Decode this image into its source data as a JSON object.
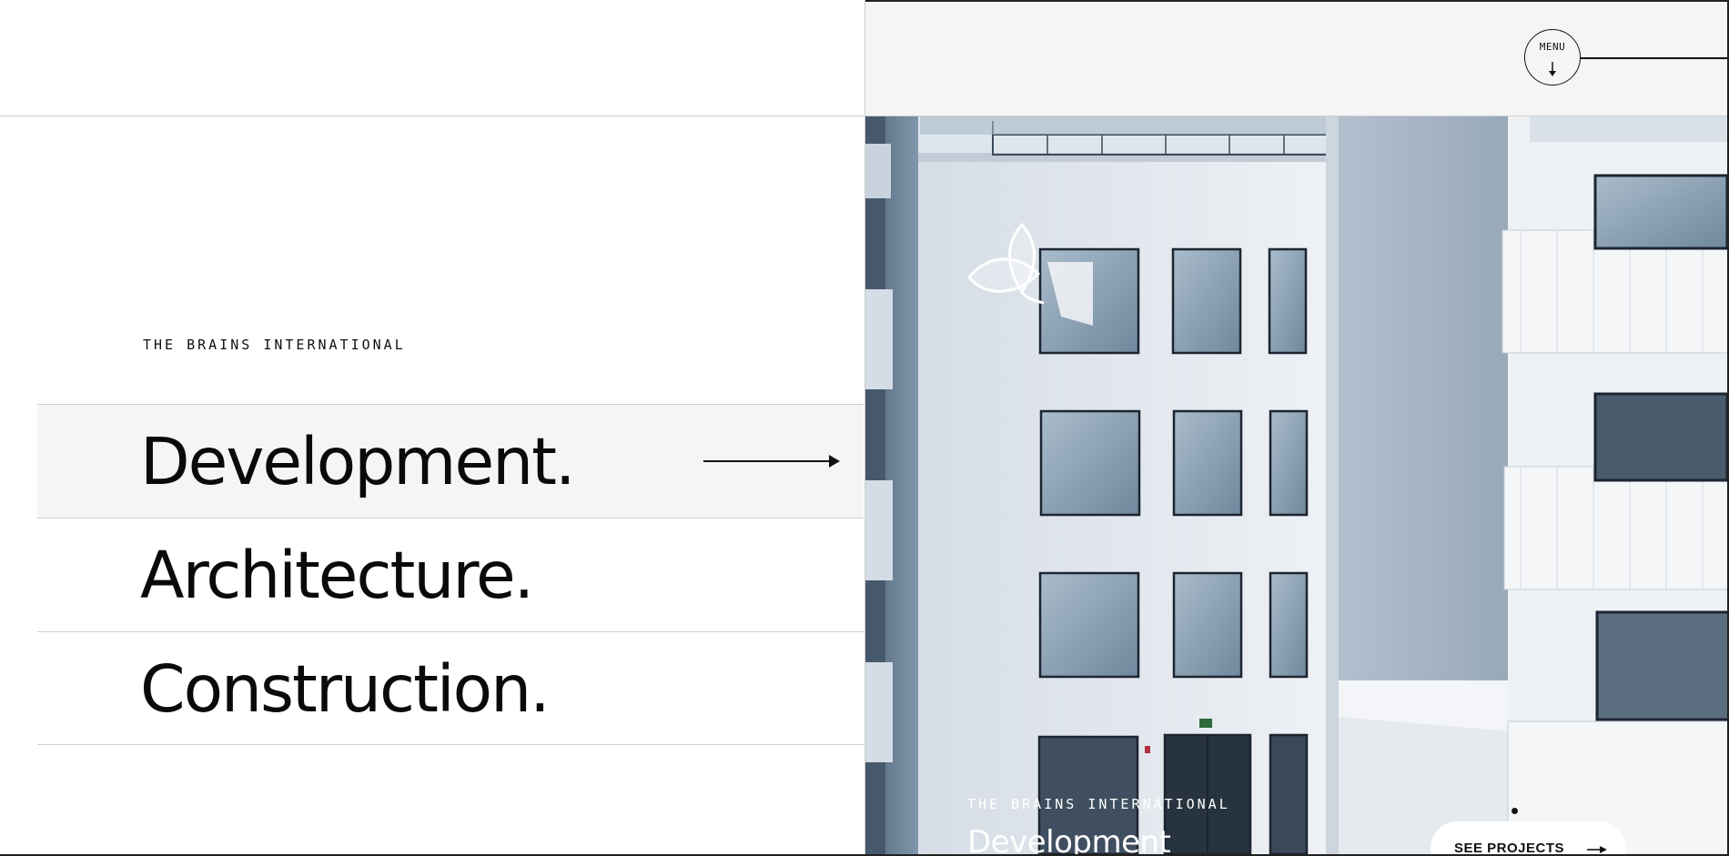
{
  "brand": {
    "eyebrow": "THE BRAINS INTERNATIONAL"
  },
  "services": [
    {
      "label": "Development.",
      "active": true
    },
    {
      "label": "Architecture.",
      "active": false
    },
    {
      "label": "Construction.",
      "active": false
    }
  ],
  "header": {
    "menu_label": "MENU"
  },
  "hero": {
    "eyebrow": "THE BRAINS INTERNATIONAL",
    "title": "Development",
    "cta_label": "SEE PROJECTS"
  },
  "icons": {
    "menu": "arrow-down-icon",
    "service_arrow": "arrow-right-icon",
    "cta_arrow": "arrow-right-icon",
    "logo": "petal-logo-icon"
  },
  "colors": {
    "text": "#0a0a0a",
    "active_row": "#f5f5f5",
    "divider": "#cfcfcf",
    "header_right": "#f5f5f5",
    "building_facade": "#e6ebf1",
    "window_glass": "#7f98ae"
  }
}
